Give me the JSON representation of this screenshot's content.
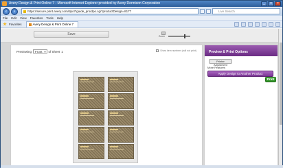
{
  "window": {
    "title": "Avery Design & Print Online 7 - Microsoft Internet Explorer provided by Avery Dennison Corporation"
  },
  "address": {
    "url": "https://secure.print.avery.com/dpo7/guide_pro/dpo.cgi?productDesign=8177",
    "search_placeholder": "Live Search"
  },
  "menu": [
    "File",
    "Edit",
    "View",
    "Favorites",
    "Tools",
    "Help"
  ],
  "favorites": {
    "label": "Favorites",
    "tab": "Avery Design & Print Online 7"
  },
  "toolbar": {
    "save_label": "Save",
    "zoom_label": "Zoom"
  },
  "preview": {
    "label": "Previewing",
    "selected": "Front",
    "of_sheet": "of Sheet",
    "sheet_num": "1",
    "show_numbers": "Show item numbers (will not print)"
  },
  "sidebar": {
    "header": "Preview & Print Options",
    "adjust_button": "Printer Adjustment",
    "more_features": "More Features",
    "apply_button": "Apply Design to Another Product",
    "print_button": "Print"
  },
  "zoom_level": 0.75,
  "colors": {
    "purple": "#7b3695",
    "green": "#2e8c25"
  }
}
